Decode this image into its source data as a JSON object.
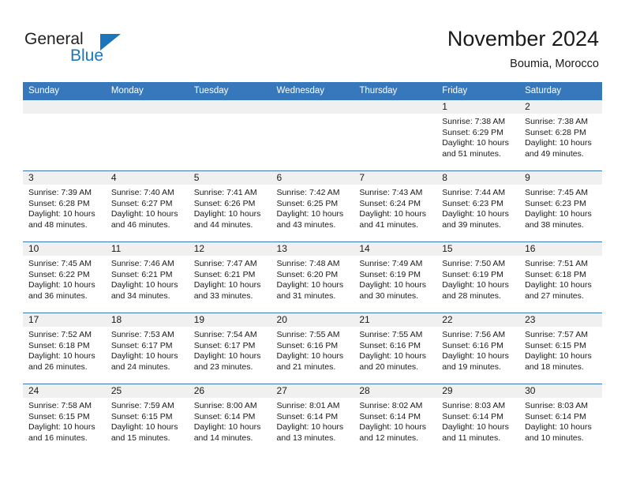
{
  "brand": {
    "name_part1": "General",
    "name_part2": "Blue",
    "accent_color": "#1b76bc"
  },
  "header": {
    "title": "November 2024",
    "location": "Boumia, Morocco"
  },
  "calendar": {
    "header_bg": "#3778bd",
    "daynum_bg": "#f0f0f0",
    "weekdays": [
      "Sunday",
      "Monday",
      "Tuesday",
      "Wednesday",
      "Thursday",
      "Friday",
      "Saturday"
    ],
    "weeks": [
      [
        {
          "day": "",
          "sunrise": "",
          "sunset": "",
          "daylight": ""
        },
        {
          "day": "",
          "sunrise": "",
          "sunset": "",
          "daylight": ""
        },
        {
          "day": "",
          "sunrise": "",
          "sunset": "",
          "daylight": ""
        },
        {
          "day": "",
          "sunrise": "",
          "sunset": "",
          "daylight": ""
        },
        {
          "day": "",
          "sunrise": "",
          "sunset": "",
          "daylight": ""
        },
        {
          "day": "1",
          "sunrise": "Sunrise: 7:38 AM",
          "sunset": "Sunset: 6:29 PM",
          "daylight": "Daylight: 10 hours and 51 minutes."
        },
        {
          "day": "2",
          "sunrise": "Sunrise: 7:38 AM",
          "sunset": "Sunset: 6:28 PM",
          "daylight": "Daylight: 10 hours and 49 minutes."
        }
      ],
      [
        {
          "day": "3",
          "sunrise": "Sunrise: 7:39 AM",
          "sunset": "Sunset: 6:28 PM",
          "daylight": "Daylight: 10 hours and 48 minutes."
        },
        {
          "day": "4",
          "sunrise": "Sunrise: 7:40 AM",
          "sunset": "Sunset: 6:27 PM",
          "daylight": "Daylight: 10 hours and 46 minutes."
        },
        {
          "day": "5",
          "sunrise": "Sunrise: 7:41 AM",
          "sunset": "Sunset: 6:26 PM",
          "daylight": "Daylight: 10 hours and 44 minutes."
        },
        {
          "day": "6",
          "sunrise": "Sunrise: 7:42 AM",
          "sunset": "Sunset: 6:25 PM",
          "daylight": "Daylight: 10 hours and 43 minutes."
        },
        {
          "day": "7",
          "sunrise": "Sunrise: 7:43 AM",
          "sunset": "Sunset: 6:24 PM",
          "daylight": "Daylight: 10 hours and 41 minutes."
        },
        {
          "day": "8",
          "sunrise": "Sunrise: 7:44 AM",
          "sunset": "Sunset: 6:23 PM",
          "daylight": "Daylight: 10 hours and 39 minutes."
        },
        {
          "day": "9",
          "sunrise": "Sunrise: 7:45 AM",
          "sunset": "Sunset: 6:23 PM",
          "daylight": "Daylight: 10 hours and 38 minutes."
        }
      ],
      [
        {
          "day": "10",
          "sunrise": "Sunrise: 7:45 AM",
          "sunset": "Sunset: 6:22 PM",
          "daylight": "Daylight: 10 hours and 36 minutes."
        },
        {
          "day": "11",
          "sunrise": "Sunrise: 7:46 AM",
          "sunset": "Sunset: 6:21 PM",
          "daylight": "Daylight: 10 hours and 34 minutes."
        },
        {
          "day": "12",
          "sunrise": "Sunrise: 7:47 AM",
          "sunset": "Sunset: 6:21 PM",
          "daylight": "Daylight: 10 hours and 33 minutes."
        },
        {
          "day": "13",
          "sunrise": "Sunrise: 7:48 AM",
          "sunset": "Sunset: 6:20 PM",
          "daylight": "Daylight: 10 hours and 31 minutes."
        },
        {
          "day": "14",
          "sunrise": "Sunrise: 7:49 AM",
          "sunset": "Sunset: 6:19 PM",
          "daylight": "Daylight: 10 hours and 30 minutes."
        },
        {
          "day": "15",
          "sunrise": "Sunrise: 7:50 AM",
          "sunset": "Sunset: 6:19 PM",
          "daylight": "Daylight: 10 hours and 28 minutes."
        },
        {
          "day": "16",
          "sunrise": "Sunrise: 7:51 AM",
          "sunset": "Sunset: 6:18 PM",
          "daylight": "Daylight: 10 hours and 27 minutes."
        }
      ],
      [
        {
          "day": "17",
          "sunrise": "Sunrise: 7:52 AM",
          "sunset": "Sunset: 6:18 PM",
          "daylight": "Daylight: 10 hours and 26 minutes."
        },
        {
          "day": "18",
          "sunrise": "Sunrise: 7:53 AM",
          "sunset": "Sunset: 6:17 PM",
          "daylight": "Daylight: 10 hours and 24 minutes."
        },
        {
          "day": "19",
          "sunrise": "Sunrise: 7:54 AM",
          "sunset": "Sunset: 6:17 PM",
          "daylight": "Daylight: 10 hours and 23 minutes."
        },
        {
          "day": "20",
          "sunrise": "Sunrise: 7:55 AM",
          "sunset": "Sunset: 6:16 PM",
          "daylight": "Daylight: 10 hours and 21 minutes."
        },
        {
          "day": "21",
          "sunrise": "Sunrise: 7:55 AM",
          "sunset": "Sunset: 6:16 PM",
          "daylight": "Daylight: 10 hours and 20 minutes."
        },
        {
          "day": "22",
          "sunrise": "Sunrise: 7:56 AM",
          "sunset": "Sunset: 6:16 PM",
          "daylight": "Daylight: 10 hours and 19 minutes."
        },
        {
          "day": "23",
          "sunrise": "Sunrise: 7:57 AM",
          "sunset": "Sunset: 6:15 PM",
          "daylight": "Daylight: 10 hours and 18 minutes."
        }
      ],
      [
        {
          "day": "24",
          "sunrise": "Sunrise: 7:58 AM",
          "sunset": "Sunset: 6:15 PM",
          "daylight": "Daylight: 10 hours and 16 minutes."
        },
        {
          "day": "25",
          "sunrise": "Sunrise: 7:59 AM",
          "sunset": "Sunset: 6:15 PM",
          "daylight": "Daylight: 10 hours and 15 minutes."
        },
        {
          "day": "26",
          "sunrise": "Sunrise: 8:00 AM",
          "sunset": "Sunset: 6:14 PM",
          "daylight": "Daylight: 10 hours and 14 minutes."
        },
        {
          "day": "27",
          "sunrise": "Sunrise: 8:01 AM",
          "sunset": "Sunset: 6:14 PM",
          "daylight": "Daylight: 10 hours and 13 minutes."
        },
        {
          "day": "28",
          "sunrise": "Sunrise: 8:02 AM",
          "sunset": "Sunset: 6:14 PM",
          "daylight": "Daylight: 10 hours and 12 minutes."
        },
        {
          "day": "29",
          "sunrise": "Sunrise: 8:03 AM",
          "sunset": "Sunset: 6:14 PM",
          "daylight": "Daylight: 10 hours and 11 minutes."
        },
        {
          "day": "30",
          "sunrise": "Sunrise: 8:03 AM",
          "sunset": "Sunset: 6:14 PM",
          "daylight": "Daylight: 10 hours and 10 minutes."
        }
      ]
    ]
  }
}
